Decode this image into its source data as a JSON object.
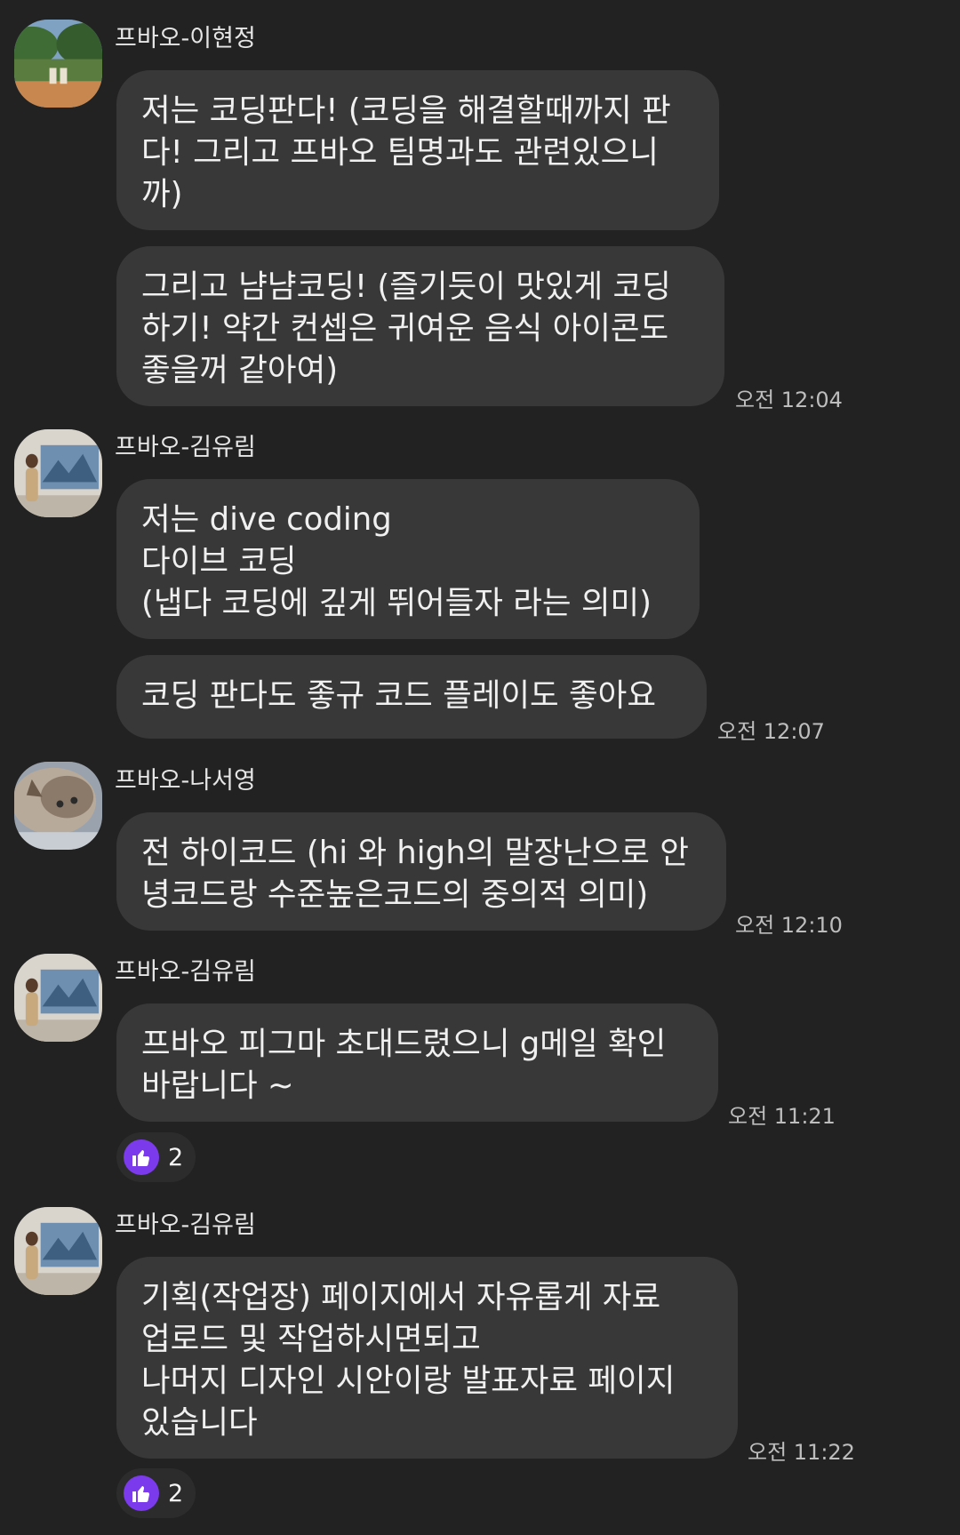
{
  "messages": [
    {
      "sender": "프바오-이현정",
      "avatar_icon": "forest-bench-photo-avatar",
      "bubbles": [
        "저는 코딩판다! (코딩을 해결할때까지 판\n다! 그리고 프바오 팀명과도 관련있으니\n까)",
        "그리고 냠냠코딩! (즐기듯이 맛있게 코딩\n하기! 약간 컨셉은 귀여운 음식 아이콘도\n좋을꺼 같아여)"
      ],
      "time": "오전 12:04"
    },
    {
      "sender": "프바오-김유림",
      "avatar_icon": "gallery-photo-avatar",
      "bubbles": [
        "저는 dive coding\n다이브 코딩\n(냅다 코딩에 깊게 뛰어들자 라는 의미)",
        "코딩 판다도 좋규 코드 플레이도 좋아요"
      ],
      "time": "오전 12:07"
    },
    {
      "sender": "프바오-나서영",
      "avatar_icon": "cat-photo-avatar",
      "bubbles": [
        "전 하이코드 (hi 와 high의 말장난으로 안\n녕코드랑 수준높은코드의 중의적 의미)"
      ],
      "time": "오전 12:10"
    },
    {
      "sender": "프바오-김유림",
      "avatar_icon": "gallery-photo-avatar",
      "bubbles": [
        "프바오 피그마 초대드렸으니 g메일 확인\n바랍니다 ~"
      ],
      "time": "오전 11:21",
      "reaction": {
        "icon": "thumbs-up-icon",
        "count": "2",
        "color": "#7c3aed"
      }
    },
    {
      "sender": "프바오-김유림",
      "avatar_icon": "gallery-photo-avatar",
      "bubbles": [
        "기획(작업장) 페이지에서 자유롭게 자료\n업로드 및 작업하시면되고\n나머지 디자인 시안이랑 발표자료 페이지\n있습니다"
      ],
      "time": "오전 11:22",
      "reaction": {
        "icon": "thumbs-up-icon",
        "count": "2",
        "color": "#7c3aed"
      }
    }
  ],
  "colors": {
    "background": "#222222",
    "bubble": "#383838",
    "reaction_accent": "#7c3aed"
  }
}
